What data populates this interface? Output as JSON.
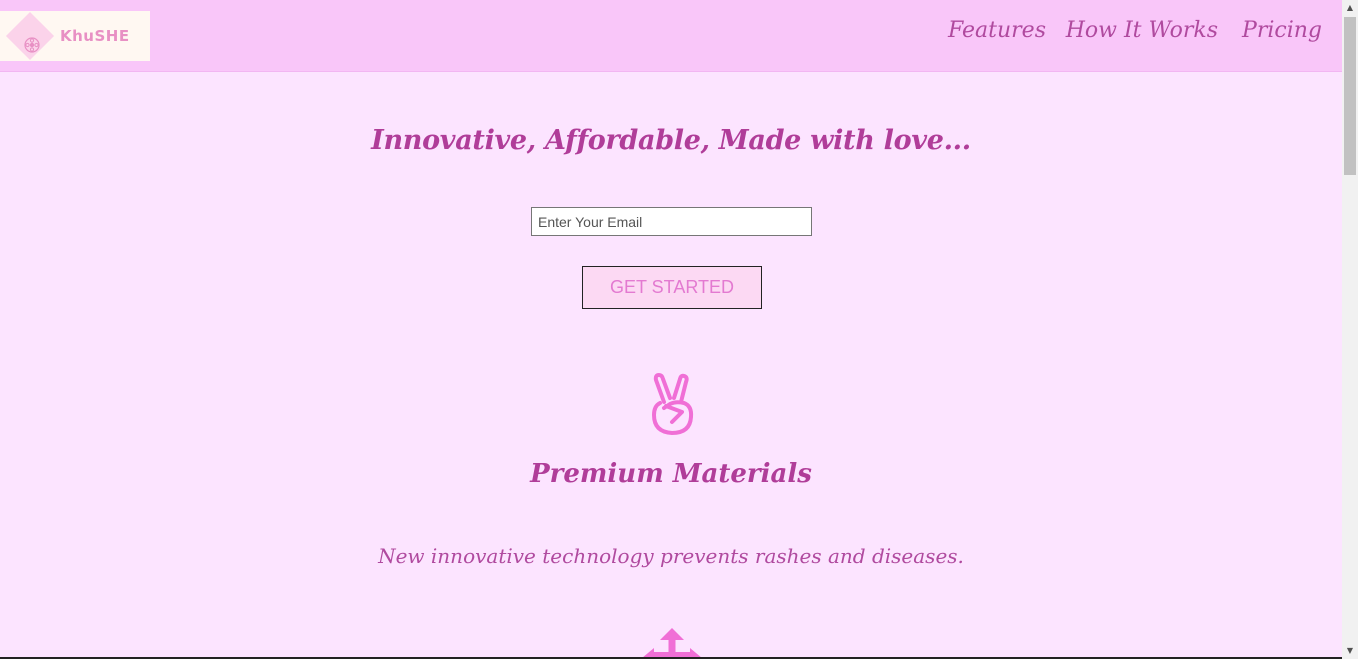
{
  "header": {
    "logo_text": "KhuSHE",
    "nav": [
      {
        "label": "Features"
      },
      {
        "label": "How It Works"
      },
      {
        "label": "Pricing"
      }
    ]
  },
  "hero": {
    "title": "Innovative, Affordable, Made with love...",
    "email_placeholder": "Enter Your Email",
    "email_value": "",
    "cta_label": "GET STARTED"
  },
  "features": [
    {
      "icon": "peace-hand-icon",
      "title": "Premium Materials",
      "text": "New innovative technology prevents rashes and diseases."
    }
  ],
  "next_icon": "arrows-icon",
  "colors": {
    "header_bg": "#f9c6f9",
    "page_bg": "#fce4ff",
    "accent": "#b03d99",
    "icon": "#f06fd6",
    "cta_text": "#e37ad1"
  }
}
